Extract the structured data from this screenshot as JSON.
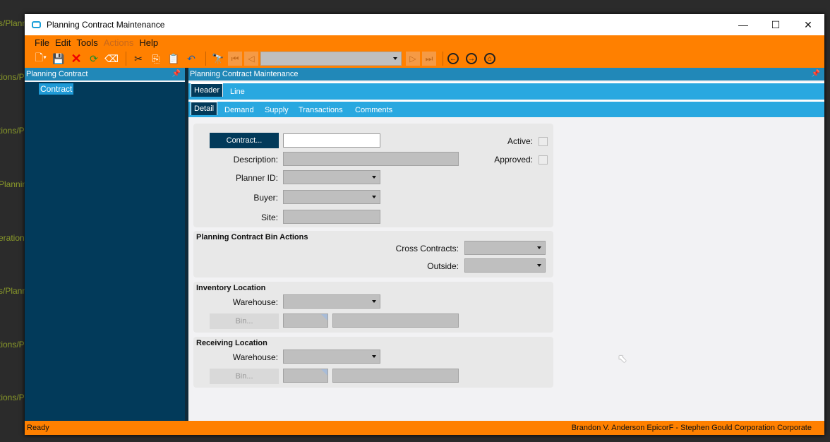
{
  "background_fragments": [
    "s/Plann",
    "tions/Pl",
    "tions/P",
    "Plannin",
    "erations",
    "s/Plann",
    "tions/Pl",
    "tions/P"
  ],
  "window": {
    "title": "Planning Contract Maintenance",
    "minimize": "—",
    "maximize": "☐",
    "close": "✕"
  },
  "menu": [
    "File",
    "Edit",
    "Tools",
    "Actions",
    "Help"
  ],
  "toolbar": {
    "nav_select_value": ""
  },
  "left_panel": {
    "title": "Planning Contract",
    "tree_item": "Contract"
  },
  "right_panel": {
    "title": "Planning Contract Maintenance"
  },
  "tabs": [
    "Header",
    "Line"
  ],
  "subtabs": [
    "Detail",
    "Demand",
    "Supply",
    "Transactions",
    "Comments"
  ],
  "form": {
    "contract_button": "Contract...",
    "contract_value": "",
    "description_label": "Description:",
    "planner_label": "Planner ID:",
    "buyer_label": "Buyer:",
    "site_label": "Site:",
    "active_label": "Active:",
    "approved_label": "Approved:",
    "active": false,
    "approved": false
  },
  "bin_actions": {
    "title": "Planning Contract Bin Actions",
    "cross_label": "Cross Contracts:",
    "outside_label": "Outside:"
  },
  "inventory": {
    "title": "Inventory Location",
    "warehouse_label": "Warehouse:",
    "bin_button": "Bin..."
  },
  "receiving": {
    "title": "Receiving Location",
    "warehouse_label": "Warehouse:",
    "bin_button": "Bin..."
  },
  "status": {
    "left": "Ready",
    "right": "Brandon V. Anderson  EpicorF - Stephen Gould Corporation  Corporate"
  }
}
